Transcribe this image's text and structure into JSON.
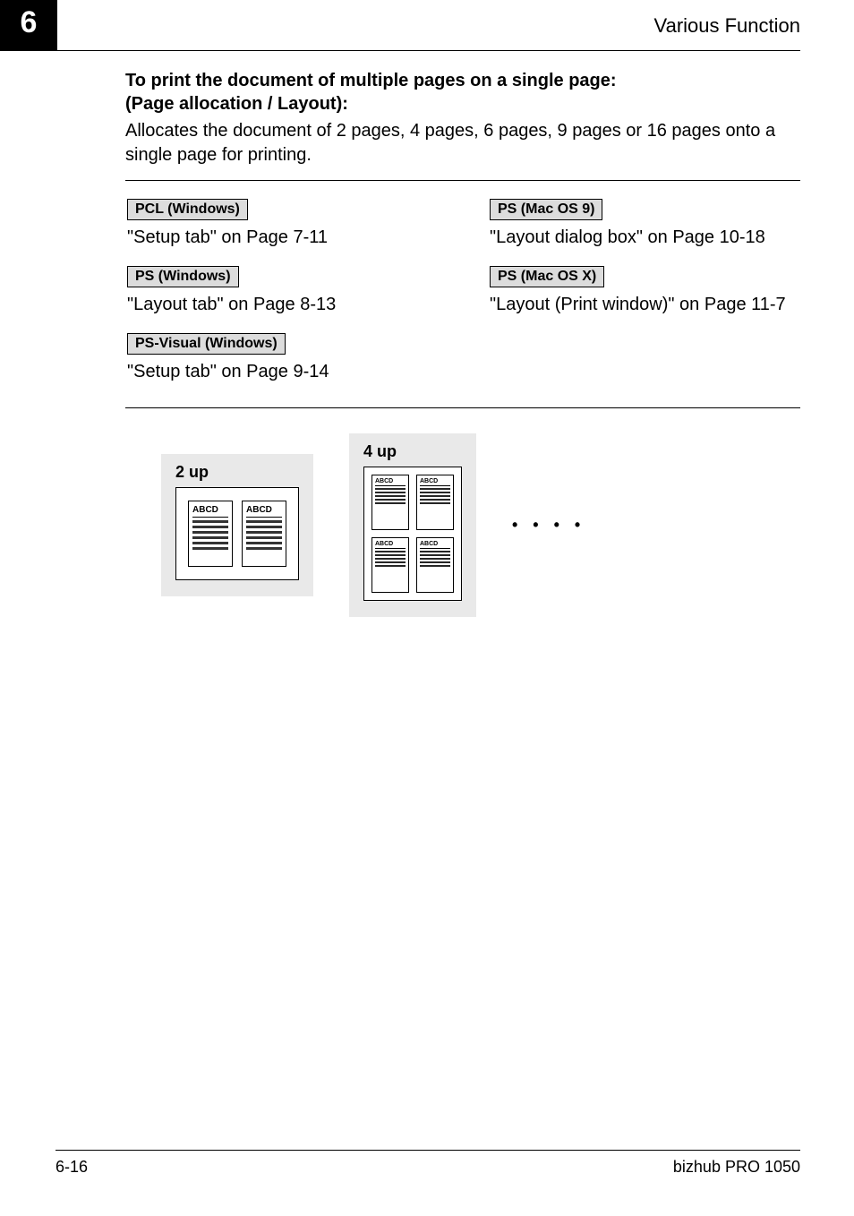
{
  "header": {
    "chapter": "6",
    "title": "Various Function"
  },
  "section": {
    "heading_line1": "To print the document of multiple pages on a single page:",
    "heading_line2": "(Page allocation / Layout):",
    "body": "Allocates the document of 2 pages, 4 pages, 6 pages, 9 pages or 16 pages onto a single page for printing."
  },
  "refs": {
    "left": [
      {
        "badge": "PCL (Windows)",
        "link": "\"Setup tab\" on Page 7-11"
      },
      {
        "badge": "PS (Windows)",
        "link": "\"Layout tab\" on Page 8-13"
      },
      {
        "badge": "PS-Visual (Windows)",
        "link": "\"Setup tab\" on Page 9-14"
      }
    ],
    "right": [
      {
        "badge": "PS (Mac OS 9)",
        "link": "\"Layout dialog box\" on Page 10-18"
      },
      {
        "badge": "PS (Mac OS X)",
        "link": "\"Layout (Print window)\" on Page 11-7"
      }
    ]
  },
  "illus": {
    "two_up_label": "2 up",
    "four_up_label": "4 up",
    "mini_title": "ABCD",
    "ellipsis": "• • • •"
  },
  "footer": {
    "left": "6-16",
    "right": "bizhub PRO 1050"
  }
}
